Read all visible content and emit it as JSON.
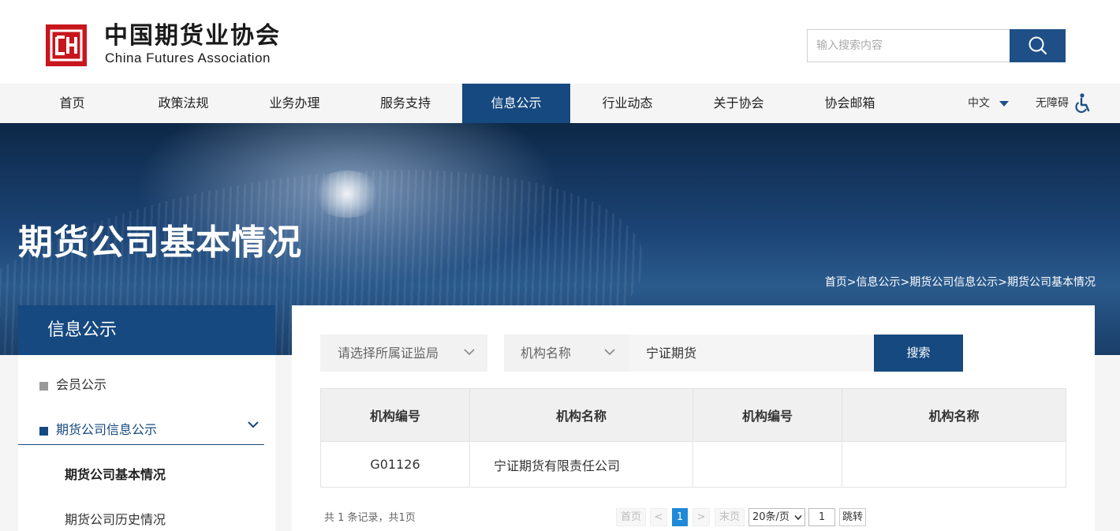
{
  "header": {
    "logo_cn": "中国期货业协会",
    "logo_en": "China Futures Association",
    "search_placeholder": "输入搜索内容"
  },
  "nav": {
    "items": [
      {
        "label": "首页"
      },
      {
        "label": "政策法规"
      },
      {
        "label": "业务办理"
      },
      {
        "label": "服务支持"
      },
      {
        "label": "信息公示",
        "active": true
      },
      {
        "label": "行业动态"
      },
      {
        "label": "关于协会"
      },
      {
        "label": "协会邮箱"
      }
    ],
    "lang": "中文",
    "accessibility": "无障碍"
  },
  "banner": {
    "title": "期货公司基本情况",
    "breadcrumb": "首页>信息公示>期货公司信息公示>期货公司基本情况"
  },
  "sidebar": {
    "title": "信息公示",
    "items": [
      {
        "label": "会员公示"
      },
      {
        "label": "期货公司信息公示",
        "expanded": true
      }
    ],
    "subitems": [
      {
        "label": "期货公司基本情况",
        "current": true
      },
      {
        "label": "期货公司历史情况"
      }
    ]
  },
  "filters": {
    "bureau_placeholder": "请选择所属证监局",
    "field_select": "机构名称",
    "keyword": "宁证期货",
    "search_label": "搜索"
  },
  "table": {
    "headers": [
      "机构编号",
      "机构名称",
      "机构编号",
      "机构名称"
    ],
    "rows": [
      [
        "G01126",
        "宁证期货有限责任公司",
        "",
        ""
      ]
    ]
  },
  "pagination": {
    "summary": "共 1 条记录，共1页",
    "first": "首页",
    "prev": "<",
    "current": "1",
    "next": ">",
    "last": "末页",
    "page_size": "20条/页",
    "goto_value": "1",
    "jump": "跳转"
  },
  "colors": {
    "brand_blue": "#15497f",
    "logo_red": "#c8161d",
    "page_active": "#1e8ad8"
  }
}
